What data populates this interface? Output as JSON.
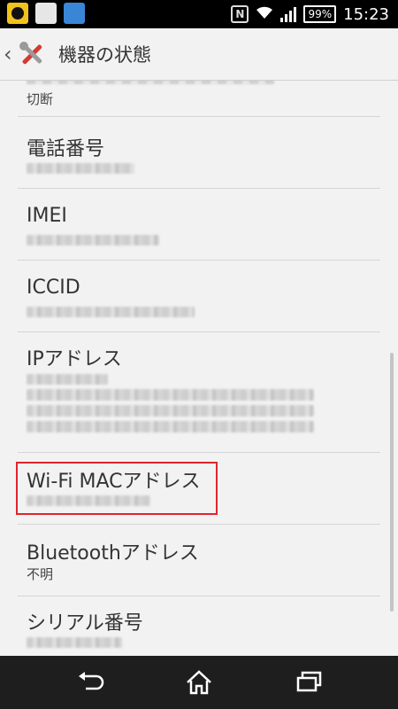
{
  "status_bar": {
    "battery": "99%",
    "time": "15:23",
    "nfc_letter": "N",
    "icons": [
      "notification-icon",
      "gmail-icon",
      "app-icon",
      "nfc-icon",
      "wifi-icon",
      "signal-icon",
      "battery-icon"
    ]
  },
  "action_bar": {
    "back_glyph": "‹",
    "title": "機器の状態"
  },
  "list": {
    "top_partial_value": "切断",
    "items": [
      {
        "label": "電話番号",
        "value": ""
      },
      {
        "label": "IMEI",
        "value": ""
      },
      {
        "label": "ICCID",
        "value": ""
      },
      {
        "label": "IPアドレス",
        "value": ""
      },
      {
        "label": "Wi-Fi MACアドレス",
        "value": ""
      },
      {
        "label": "Bluetoothアドレス",
        "value": "不明"
      },
      {
        "label": "シリアル番号",
        "value": ""
      }
    ]
  },
  "nav_bar": {
    "buttons": [
      "back",
      "home",
      "recents"
    ]
  },
  "colors": {
    "highlight": "#e0242d",
    "background": "#f2f2f2",
    "nav_background": "#1e1e1e"
  }
}
